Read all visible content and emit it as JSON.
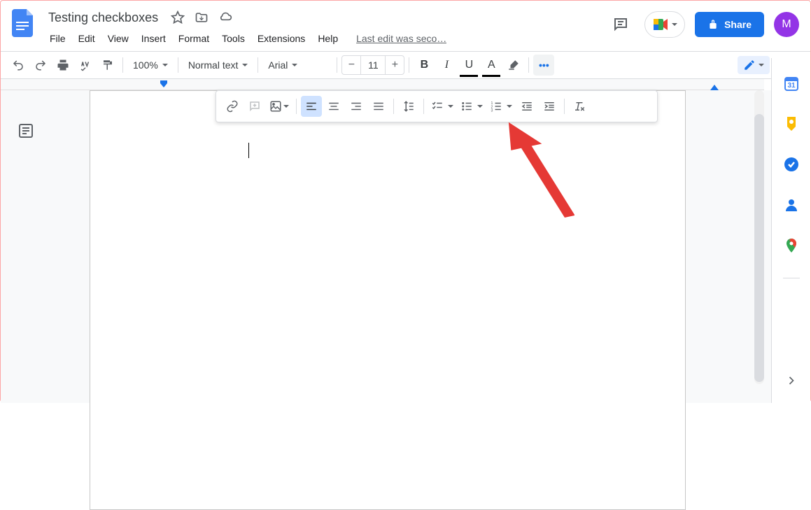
{
  "header": {
    "doc_title": "Testing checkboxes",
    "share_label": "Share",
    "avatar_initial": "M",
    "last_edit": "Last edit was seco…"
  },
  "menu": {
    "items": [
      "File",
      "Edit",
      "View",
      "Insert",
      "Format",
      "Tools",
      "Extensions",
      "Help"
    ]
  },
  "toolbar": {
    "zoom": "100%",
    "style": "Normal text",
    "font": "Arial",
    "font_size": "11"
  },
  "side_panel": {
    "calendar_day": "31"
  }
}
